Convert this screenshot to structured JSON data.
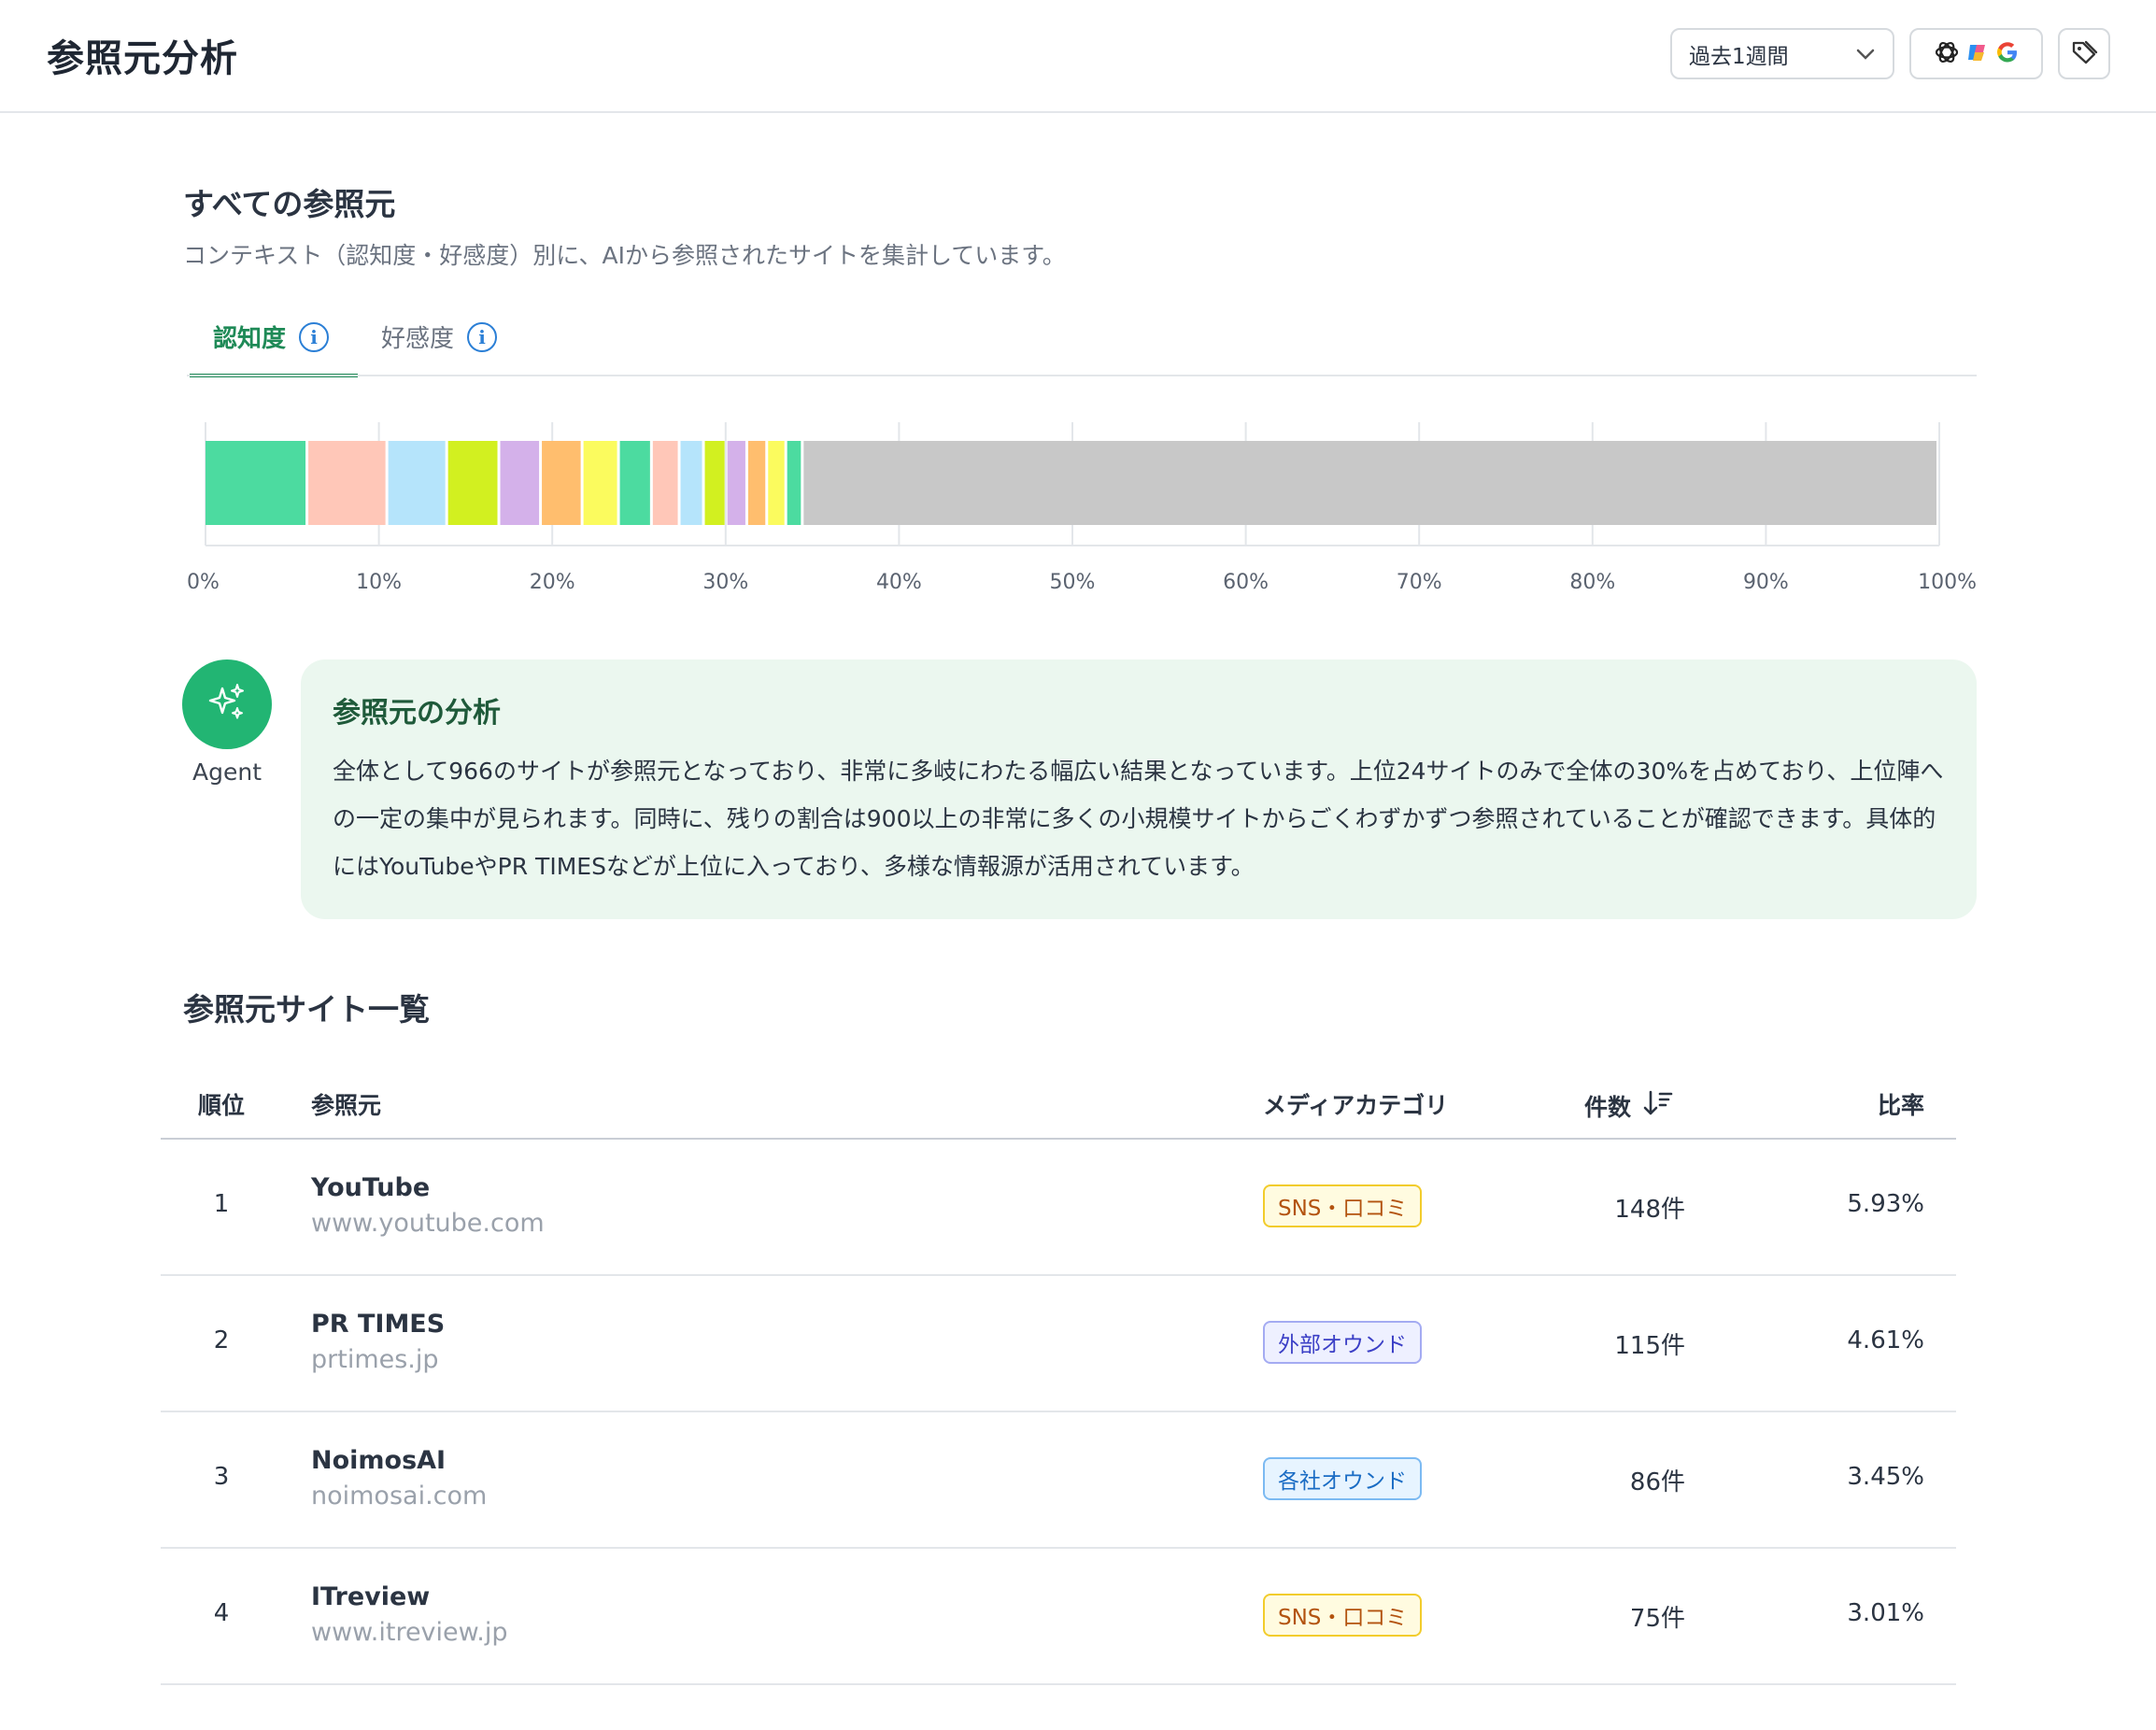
{
  "header": {
    "title": "参照元分析",
    "period": {
      "selected": "過去1週間"
    },
    "icons": [
      "chevron-down-icon",
      "openai-icon",
      "copilot-icon",
      "google-icon",
      "tag-icon"
    ]
  },
  "section": {
    "title": "すべての参照元",
    "description": "コンテキスト（認知度・好感度）別に、AIから参照されたサイトを集計しています。"
  },
  "tabs": [
    {
      "label": "認知度",
      "active": true
    },
    {
      "label": "好感度",
      "active": false
    }
  ],
  "chart_data": {
    "type": "bar",
    "orientation": "horizontal-stacked",
    "x_ticks": [
      "0%",
      "10%",
      "20%",
      "30%",
      "40%",
      "50%",
      "60%",
      "70%",
      "80%",
      "90%",
      "100%"
    ],
    "xlim": [
      0,
      100
    ],
    "grid": true,
    "segments": [
      {
        "value": 5.93,
        "color": "#4cdba0"
      },
      {
        "value": 4.61,
        "color": "#ffc7b8"
      },
      {
        "value": 3.45,
        "color": "#b5e4fb"
      },
      {
        "value": 3.01,
        "color": "#d2f020"
      },
      {
        "value": 2.4,
        "color": "#d4b1ea"
      },
      {
        "value": 2.4,
        "color": "#ffbe6e"
      },
      {
        "value": 2.1,
        "color": "#fbfb5e"
      },
      {
        "value": 1.9,
        "color": "#4cdba0"
      },
      {
        "value": 1.6,
        "color": "#ffc7b8"
      },
      {
        "value": 1.4,
        "color": "#b5e4fb"
      },
      {
        "value": 1.3,
        "color": "#d2f020"
      },
      {
        "value": 1.2,
        "color": "#d4b1ea"
      },
      {
        "value": 1.15,
        "color": "#ffbe6e"
      },
      {
        "value": 1.1,
        "color": "#fbfb5e"
      },
      {
        "value": 0.95,
        "color": "#4cdba0"
      },
      {
        "value": 65.5,
        "color": "#c8c8c8"
      }
    ]
  },
  "agent": {
    "label": "Agent",
    "title": "参照元の分析",
    "body": "全体として966のサイトが参照元となっており、非常に多岐にわたる幅広い結果となっています。上位24サイトのみで全体の30%を占めており、上位陣への一定の集中が見られます。同時に、残りの割合は900以上の非常に多くの小規模サイトからごくわずかずつ参照されていることが確認できます。具体的にはYouTubeやPR TIMESなどが上位に入っており、多様な情報源が活用されています。"
  },
  "list": {
    "title": "参照元サイト一覧",
    "columns": {
      "rank": "順位",
      "source": "参照元",
      "category": "メディアカテゴリ",
      "count": "件数",
      "ratio": "比率"
    },
    "rows": [
      {
        "rank": "1",
        "name": "YouTube",
        "url": "www.youtube.com",
        "category": "SNS・口コミ",
        "category_type": "sns",
        "count": "148件",
        "ratio": "5.93%"
      },
      {
        "rank": "2",
        "name": "PR TIMES",
        "url": "prtimes.jp",
        "category": "外部オウンド",
        "category_type": "ext",
        "count": "115件",
        "ratio": "4.61%"
      },
      {
        "rank": "3",
        "name": "NoimosAI",
        "url": "noimosai.com",
        "category": "各社オウンド",
        "category_type": "own",
        "count": "86件",
        "ratio": "3.45%"
      },
      {
        "rank": "4",
        "name": "ITreview",
        "url": "www.itreview.jp",
        "category": "SNS・口コミ",
        "category_type": "sns",
        "count": "75件",
        "ratio": "3.01%"
      }
    ]
  }
}
